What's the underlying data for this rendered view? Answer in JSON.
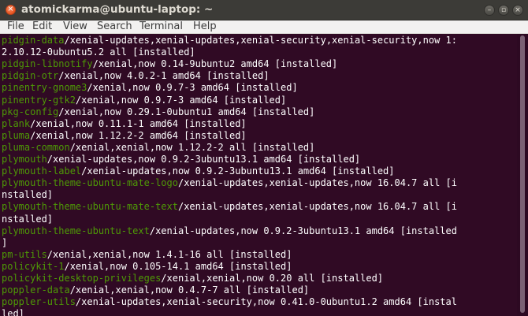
{
  "window": {
    "title": "atomickarma@ubuntu-laptop: ~",
    "controls": {
      "close": "×",
      "minimize": "–",
      "maximize": "▫",
      "restore": "×"
    }
  },
  "menu": [
    "File",
    "Edit",
    "View",
    "Search",
    "Terminal",
    "Help"
  ],
  "lines": [
    {
      "pkg": "pidgin-data",
      "rest": "/xenial-updates,xenial-updates,xenial-security,xenial-security,now 1:"
    },
    {
      "pkg": "",
      "rest": "2.10.12-0ubuntu5.2 all [installed]"
    },
    {
      "pkg": "pidgin-libnotify",
      "rest": "/xenial,now 0.14-9ubuntu2 amd64 [installed]"
    },
    {
      "pkg": "pidgin-otr",
      "rest": "/xenial,now 4.0.2-1 amd64 [installed]"
    },
    {
      "pkg": "pinentry-gnome3",
      "rest": "/xenial,now 0.9.7-3 amd64 [installed]"
    },
    {
      "pkg": "pinentry-gtk2",
      "rest": "/xenial,now 0.9.7-3 amd64 [installed]"
    },
    {
      "pkg": "pkg-config",
      "rest": "/xenial,now 0.29.1-0ubuntu1 amd64 [installed]"
    },
    {
      "pkg": "plank",
      "rest": "/xenial,now 0.11.1-1 amd64 [installed]"
    },
    {
      "pkg": "pluma",
      "rest": "/xenial,now 1.12.2-2 amd64 [installed]"
    },
    {
      "pkg": "pluma-common",
      "rest": "/xenial,xenial,now 1.12.2-2 all [installed]"
    },
    {
      "pkg": "plymouth",
      "rest": "/xenial-updates,now 0.9.2-3ubuntu13.1 amd64 [installed]"
    },
    {
      "pkg": "plymouth-label",
      "rest": "/xenial-updates,now 0.9.2-3ubuntu13.1 amd64 [installed]"
    },
    {
      "pkg": "plymouth-theme-ubuntu-mate-logo",
      "rest": "/xenial-updates,xenial-updates,now 16.04.7 all [i"
    },
    {
      "pkg": "",
      "rest": "nstalled]"
    },
    {
      "pkg": "plymouth-theme-ubuntu-mate-text",
      "rest": "/xenial-updates,xenial-updates,now 16.04.7 all [i"
    },
    {
      "pkg": "",
      "rest": "nstalled]"
    },
    {
      "pkg": "plymouth-theme-ubuntu-text",
      "rest": "/xenial-updates,now 0.9.2-3ubuntu13.1 amd64 [installed"
    },
    {
      "pkg": "",
      "rest": "]"
    },
    {
      "pkg": "pm-utils",
      "rest": "/xenial,xenial,now 1.4.1-16 all [installed]"
    },
    {
      "pkg": "policykit-1",
      "rest": "/xenial,now 0.105-14.1 amd64 [installed]"
    },
    {
      "pkg": "policykit-desktop-privileges",
      "rest": "/xenial,xenial,now 0.20 all [installed]"
    },
    {
      "pkg": "poppler-data",
      "rest": "/xenial,xenial,now 0.4.7-7 all [installed]"
    },
    {
      "pkg": "poppler-utils",
      "rest": "/xenial-updates,xenial-security,now 0.41.0-0ubuntu1.2 amd64 [instal"
    },
    {
      "pkg": "",
      "rest": "led]"
    }
  ]
}
